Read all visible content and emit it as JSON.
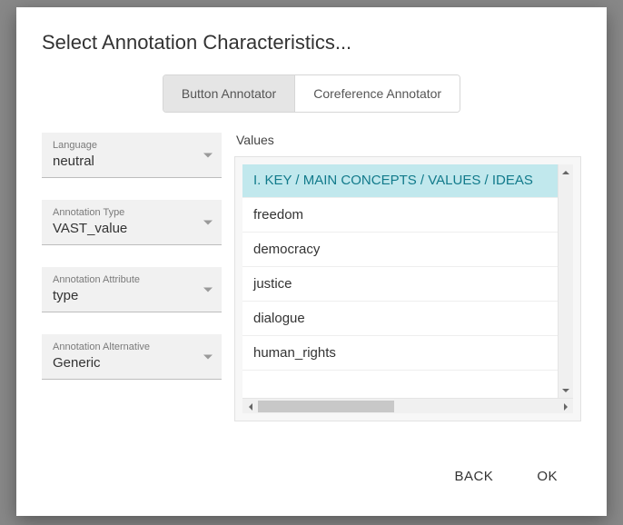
{
  "title": "Select Annotation Characteristics...",
  "tabs": {
    "button": "Button Annotator",
    "coreference": "Coreference Annotator"
  },
  "dropdowns": {
    "language": {
      "label": "Language",
      "value": "neutral"
    },
    "annotation_type": {
      "label": "Annotation Type",
      "value": "VAST_value"
    },
    "annotation_attribute": {
      "label": "Annotation Attribute",
      "value": "type"
    },
    "annotation_alternative": {
      "label": "Annotation Alternative",
      "value": "Generic"
    }
  },
  "values": {
    "label": "Values",
    "items": [
      {
        "text": "I. KEY / MAIN CONCEPTS / VALUES / IDEAS",
        "header": true
      },
      {
        "text": "freedom",
        "header": false
      },
      {
        "text": "democracy",
        "header": false
      },
      {
        "text": "justice",
        "header": false
      },
      {
        "text": "dialogue",
        "header": false
      },
      {
        "text": "human_rights",
        "header": false
      }
    ]
  },
  "actions": {
    "back": "BACK",
    "ok": "OK"
  }
}
